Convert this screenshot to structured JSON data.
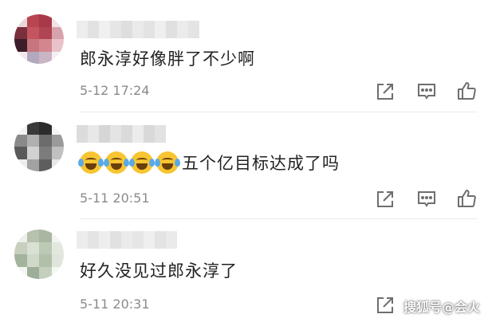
{
  "comments": [
    {
      "text": "郎永淳好像胖了不少啊",
      "time": "5-12 17:24",
      "emoji_count": 0
    },
    {
      "text": "五个亿目标达成了吗",
      "time": "5-11 20:51",
      "emoji_count": 4,
      "emoji_icon": "laugh-cry-emoji-icon"
    },
    {
      "text": "好久没见过郎永淳了",
      "time": "5-11 20:31",
      "emoji_count": 0
    }
  ],
  "actions": [
    {
      "icon": "share-icon"
    },
    {
      "icon": "comment-icon"
    },
    {
      "icon": "thumbs-up-icon"
    }
  ],
  "watermark": "搜狐号@会火",
  "colors": {
    "text": "#222222",
    "timestamp": "#8a8a8a",
    "icon": "#6e6e6e",
    "emoji": "#f7c531"
  }
}
